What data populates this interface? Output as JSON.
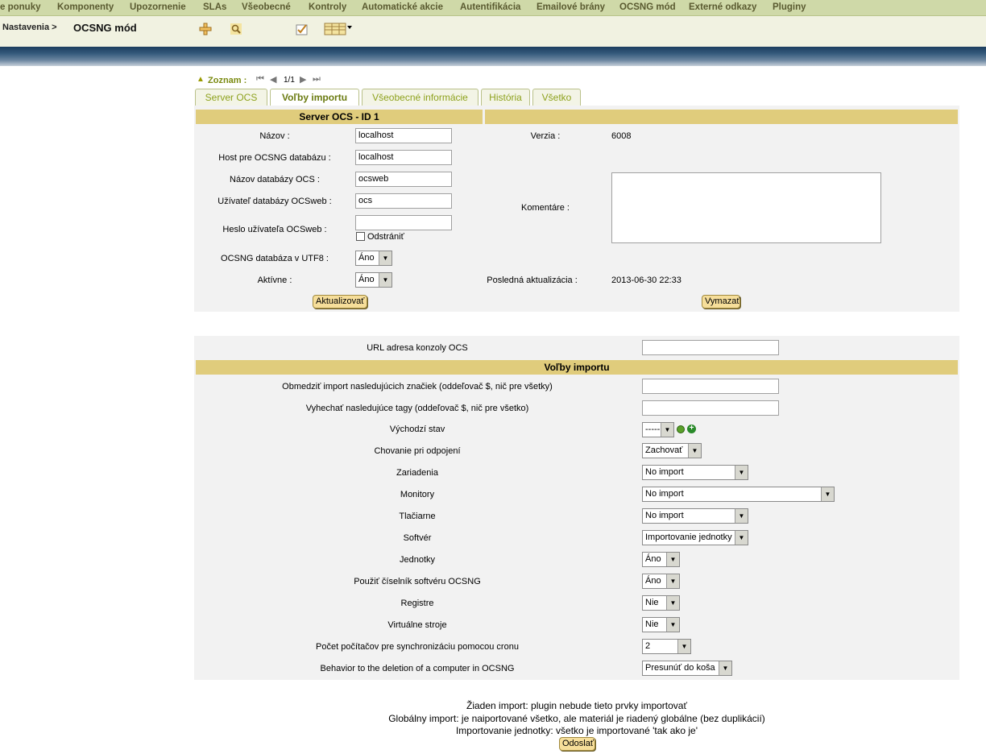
{
  "menu": {
    "items": [
      "e ponuky",
      "Komponenty",
      "Upozornenie",
      "SLAs",
      "Všeobecné",
      "Kontroly",
      "Automatické akcie",
      "Autentifikácia",
      "Emailové brány",
      "OCSNG mód",
      "Externé odkazy",
      "Pluginy"
    ]
  },
  "breadcrumb": {
    "label": "Nastavenia >",
    "current": "OCSNG mód"
  },
  "listnav": {
    "label": "Zoznam :",
    "count": "1/1"
  },
  "tabs": [
    "Server OCS",
    "Voľby importu",
    "Všeobecné informácie",
    "História",
    "Všetko"
  ],
  "server": {
    "header": "Server OCS - ID 1",
    "name_label": "Názov :",
    "name_value": "localhost",
    "host_label": "Host pre OCSNG databázu :",
    "host_value": "localhost",
    "dbname_label": "Názov databázy OCS :",
    "dbname_value": "ocsweb",
    "dbuser_label": "Užívateľ databázy OCSweb :",
    "dbuser_value": "ocs",
    "pass_label": "Heslo užívateľa OCSweb :",
    "pass_value": "",
    "remove_label": "Odstrániť",
    "utf8_label": "OCSNG databáza v UTF8 :",
    "utf8_value": "Áno",
    "active_label": "Aktívne :",
    "active_value": "Áno",
    "version_label": "Verzia :",
    "version_value": "6008",
    "comments_label": "Komentáre :",
    "lastupdate_label": "Posledná aktualizácia :",
    "lastupdate_value": "2013-06-30 22:33",
    "update_button": "Aktualizovať",
    "delete_button": "Vymazať"
  },
  "import": {
    "url_label": "URL adresa konzoly OCS",
    "url_value": "",
    "header": "Voľby importu",
    "tags_limit_label": "Obmedziť import nasledujúcich značiek (oddeľovač $, nič pre všetky)",
    "tags_limit_value": "",
    "tags_exclude_label": "Vyhechať nasledujúce tagy (oddeľovač $, nič pre všetko)",
    "tags_exclude_value": "",
    "default_state_label": "Východzí stav",
    "default_state_value": "-----",
    "disconnect_label": "Chovanie pri odpojení",
    "disconnect_value": "Zachovať",
    "devices_label": "Zariadenia",
    "devices_value": "No import",
    "monitors_label": "Monitory",
    "monitors_value": "No import",
    "printers_label": "Tlačiarne",
    "printers_value": "No import",
    "software_label": "Softvér",
    "software_value": "Importovanie jednotky",
    "volumes_label": "Jednotky",
    "volumes_value": "Áno",
    "dictionary_label": "Použiť číselník softvéru OCSNG",
    "dictionary_value": "Áno",
    "registry_label": "Registre",
    "registry_value": "Nie",
    "vm_label": "Virtuálne stroje",
    "vm_value": "Nie",
    "cron_label": "Počet počítačov pre synchronizáciu pomocou cronu",
    "cron_value": "2",
    "deletion_label": "Behavior to the deletion of a computer in OCSNG",
    "deletion_value": "Presunúť do koša"
  },
  "notes": {
    "line1": "Žiaden import: plugin nebude tieto prvky importovať",
    "line2": "Globálny import: je naiportované všetko, ale materiál je riadený globálne (bez duplikácií)",
    "line3": "Importovanie jednotky: všetko je importované 'tak ako je'",
    "submit_button": "Odoslať"
  }
}
